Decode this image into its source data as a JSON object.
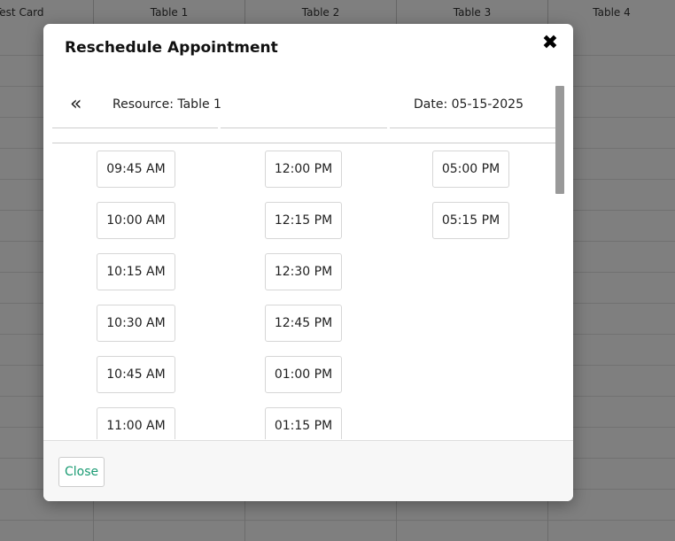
{
  "background": {
    "columns": [
      "Test Card",
      "Table 1",
      "Table 2",
      "Table 3",
      "Table 4"
    ]
  },
  "modal": {
    "title": "Reschedule Appointment",
    "close_icon": "✖",
    "prev_icon": "«",
    "resource_label": "Resource: Table 1",
    "date_label": "Date: 05-15-2025",
    "columns": [
      [
        "09:45 AM",
        "10:00 AM",
        "10:15 AM",
        "10:30 AM",
        "10:45 AM",
        "11:00 AM"
      ],
      [
        "12:00 PM",
        "12:15 PM",
        "12:30 PM",
        "12:45 PM",
        "01:00 PM",
        "01:15 PM"
      ],
      [
        "05:00 PM",
        "05:15 PM"
      ]
    ],
    "footer_close_label": "Close"
  },
  "colors": {
    "accent": "#1a9b73"
  }
}
